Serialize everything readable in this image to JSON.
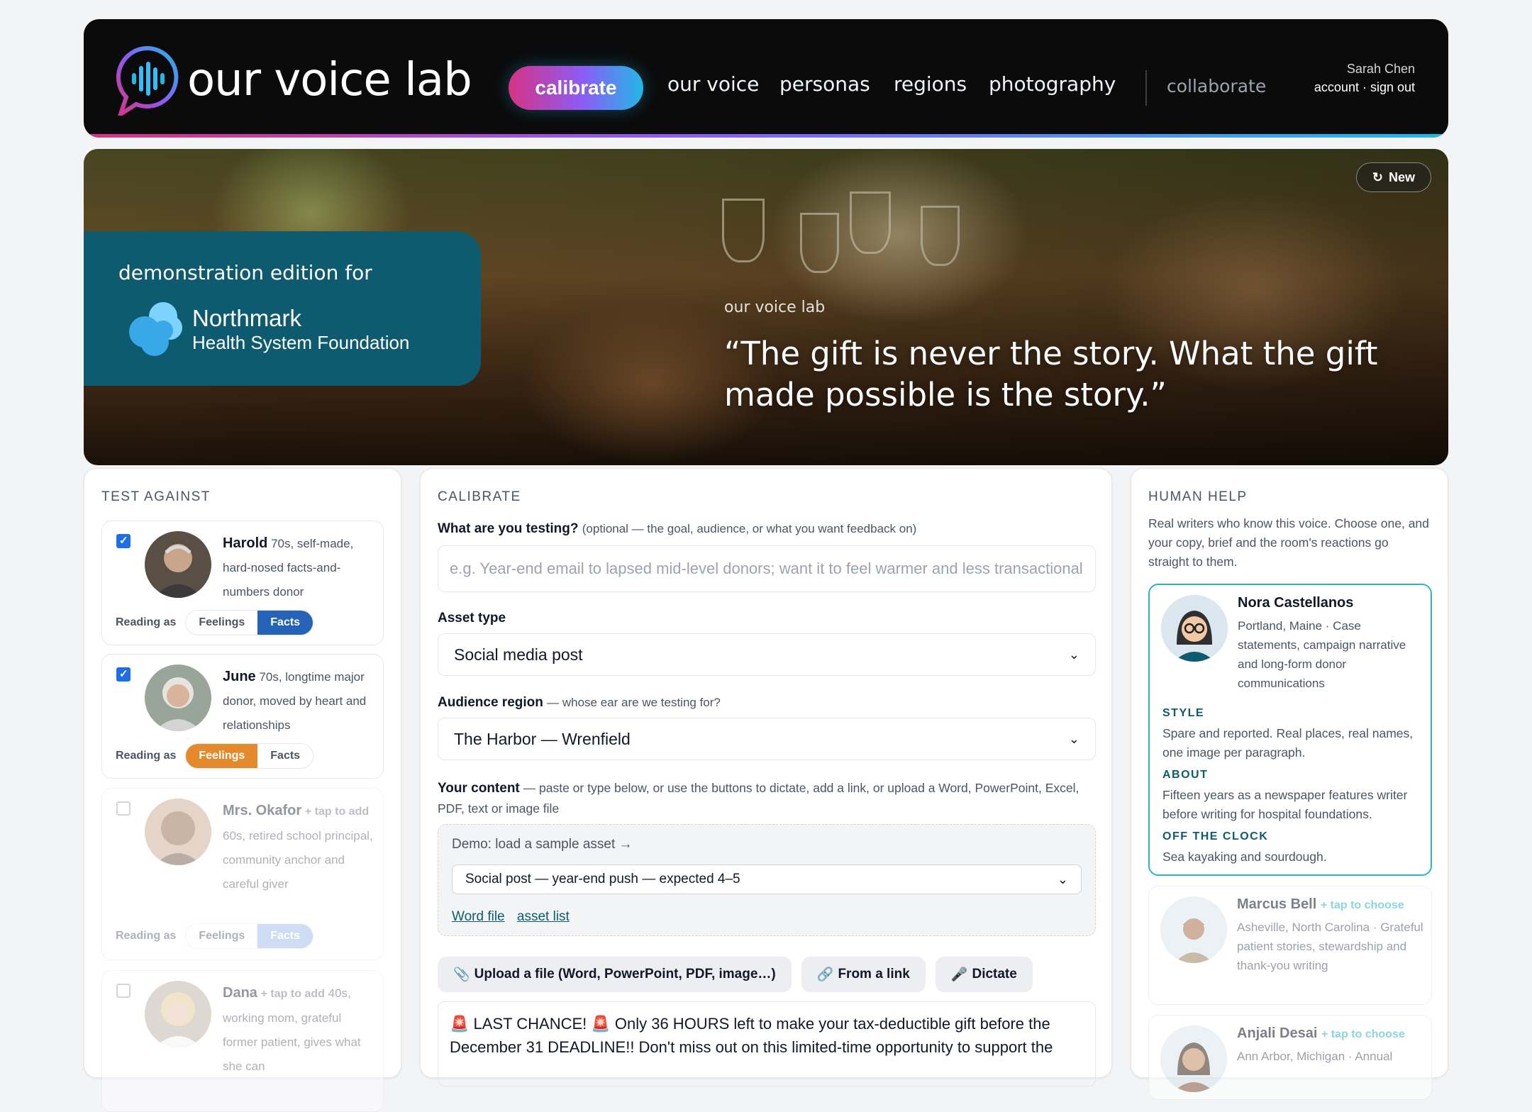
{
  "header": {
    "brand": "our voice lab",
    "cta": "calibrate",
    "nav": [
      "our voice",
      "personas",
      "regions",
      "photography"
    ],
    "secondary": "collaborate",
    "user_name": "Sarah Chen",
    "user_links": "account · sign out",
    "colors": {
      "gradient_start": "#d63384",
      "gradient_mid": "#8b5cf6",
      "gradient_end": "#22b8e6"
    }
  },
  "hero": {
    "new_button": "New",
    "new_icon": "refresh-icon",
    "demo_label": "demonstration edition for",
    "org_name": "Northmark",
    "org_sub": "Health System Foundation",
    "quote_tag": "our voice lab",
    "quote": "“The gift is never the story. What the gift made possible is the story.”",
    "card_color": "#0e5b70"
  },
  "test_against": {
    "title": "TEST AGAINST",
    "reading_as_label": "Reading as",
    "feelings_label": "Feelings",
    "facts_label": "Facts",
    "readers": [
      {
        "name": "Harold",
        "desc": "70s, self-made, hard-nosed facts-and-numbers donor",
        "checked": true,
        "mode": "Facts"
      },
      {
        "name": "June",
        "desc": "70s, longtime major donor, moved by heart and relationships",
        "checked": true,
        "mode": "Feelings"
      },
      {
        "name": "Mrs. Okafor",
        "add": "+ tap to add",
        "desc": "60s, retired school principal, community anchor and careful giver",
        "checked": false,
        "mode": "Facts"
      },
      {
        "name": "Dana",
        "add": "+ tap to add",
        "desc": "40s, working mom, grateful former patient, gives what she can",
        "checked": false
      }
    ]
  },
  "calibrate": {
    "title": "CALIBRATE",
    "testing_label": "What are you testing?",
    "testing_hint": "(optional — the goal, audience, or what you want feedback on)",
    "testing_placeholder": "e.g. Year-end email to lapsed mid-level donors; want it to feel warmer and less transactional",
    "asset_label": "Asset type",
    "asset_value": "Social media post",
    "region_label": "Audience region",
    "region_hint": "— whose ear are we testing for?",
    "region_value": "The Harbor — Wrenfield",
    "content_label": "Your content",
    "content_hint": "— paste or type below, or use the buttons to dictate, add a link, or upload a Word, PowerPoint, Excel, PDF, text or image file",
    "demo_label": "Demo: load a sample asset →",
    "demo_value": "Social post — year-end push — expected 4–5",
    "demo_links": [
      "Word file",
      "asset list"
    ],
    "actions": [
      {
        "label": "Upload a file (Word, PowerPoint, PDF, image…)",
        "icon": "paperclip-icon"
      },
      {
        "label": "From a link",
        "icon": "link-icon"
      },
      {
        "label": "Dictate",
        "icon": "microphone-icon"
      }
    ],
    "content_text": "🚨 LAST CHANCE! 🚨 Only 36 HOURS left to make your tax-deductible gift before the December 31 DEADLINE!! Don't miss out on this limited-time opportunity to support the"
  },
  "human_help": {
    "title": "HUMAN HELP",
    "intro": "Real writers who know this voice. Choose one, and your copy, brief and the room's reactions go straight to them.",
    "choose_label": "+ tap to choose",
    "selected": {
      "name": "Nora Castellanos",
      "meta": "Portland, Maine · Case statements, campaign narrative and long-form donor communications",
      "style_label": "STYLE",
      "style": "Spare and reported. Real places, real names, one image per paragraph.",
      "about_label": "ABOUT",
      "about": "Fifteen years as a newspaper features writer before writing for hospital foundations.",
      "off_label": "OFF THE CLOCK",
      "off": "Sea kayaking and sourdough."
    },
    "others": [
      {
        "name": "Marcus Bell",
        "meta": "Asheville, North Carolina · Grateful patient stories, stewardship and thank-you writing"
      },
      {
        "name": "Anjali Desai",
        "meta": "Ann Arbor, Michigan · Annual"
      }
    ]
  }
}
